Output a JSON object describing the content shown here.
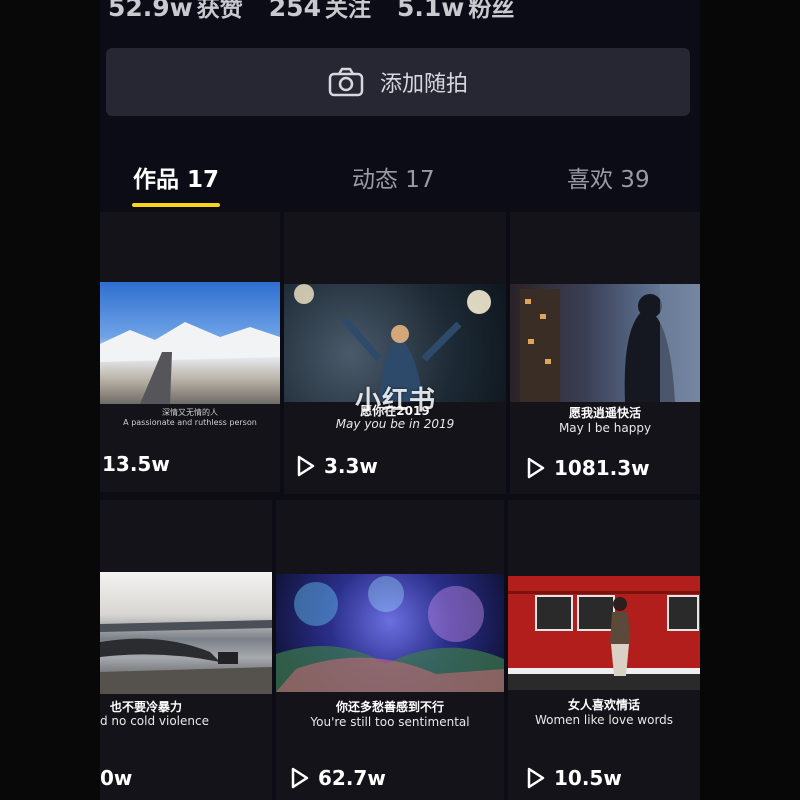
{
  "profile": {
    "stats": [
      {
        "value": "52.9w",
        "label": "获赞"
      },
      {
        "value": "254",
        "label": "关注"
      },
      {
        "value": "5.1w",
        "label": "粉丝"
      }
    ]
  },
  "add_snapshot": {
    "label": "添加随拍",
    "icon": "camera-icon"
  },
  "tabs": [
    {
      "label": "作品 17",
      "active": true
    },
    {
      "label": "动态 17",
      "active": false
    },
    {
      "label": "喜欢 39",
      "active": false
    }
  ],
  "videos": [
    {
      "caption_cn": "深情又无情的人",
      "caption_en": "A passionate and ruthless person",
      "plays": "13.5w"
    },
    {
      "caption_cn": "愿你在2019",
      "caption_en": "May you be in 2019",
      "plays": "3.3w"
    },
    {
      "caption_cn": "愿我逍遥快活",
      "caption_en": "May I be happy",
      "plays": "1081.3w"
    },
    {
      "caption_cn": "也不要冷暴力",
      "caption_en": "d no cold violence",
      "plays": "0w"
    },
    {
      "caption_cn": "你还多愁善感到不行",
      "caption_en": "You're still too sentimental",
      "plays": "62.7w"
    },
    {
      "caption_cn": "女人喜欢情话",
      "caption_en": "Women like love words",
      "plays": "10.5w"
    }
  ],
  "watermark": "小红书",
  "colors": {
    "accent": "#f8d41c",
    "background": "#0b0c15",
    "button": "#262733"
  }
}
